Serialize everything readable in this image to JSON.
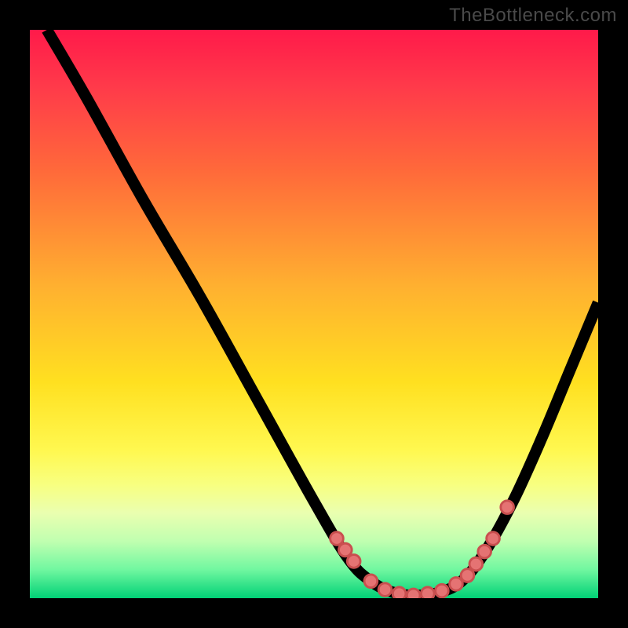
{
  "watermark": "TheBottleneck.com",
  "colors": {
    "bg": "#000000",
    "gradient_top": "#ff1a4a",
    "gradient_bottom": "#00d176",
    "curve": "#000000",
    "dot_fill": "#e57373",
    "dot_stroke": "#c94f4f"
  },
  "chart_data": {
    "type": "line",
    "title": "",
    "xlabel": "",
    "ylabel": "",
    "xlim": [
      0,
      100
    ],
    "ylim": [
      0,
      100
    ],
    "grid": false,
    "legend": false,
    "series": [
      {
        "name": "curve",
        "x": [
          3,
          10,
          20,
          30,
          40,
          50,
          56,
          60,
          64,
          68,
          72,
          76,
          80,
          85,
          90,
          95,
          100
        ],
        "y": [
          100,
          88,
          70,
          53,
          35,
          17,
          7,
          3,
          1,
          0.5,
          1,
          3,
          8,
          17,
          28,
          40,
          52
        ],
        "type": "line"
      },
      {
        "name": "highlight-dots",
        "x": [
          54,
          55.5,
          57,
          60,
          62.5,
          65,
          67.5,
          70,
          72.5,
          75,
          77,
          78.5,
          80,
          81.5,
          84
        ],
        "y": [
          10.5,
          8.5,
          6.5,
          3,
          1.5,
          0.8,
          0.5,
          0.8,
          1.3,
          2.5,
          4,
          6,
          8.2,
          10.5,
          16
        ],
        "type": "scatter"
      }
    ]
  }
}
